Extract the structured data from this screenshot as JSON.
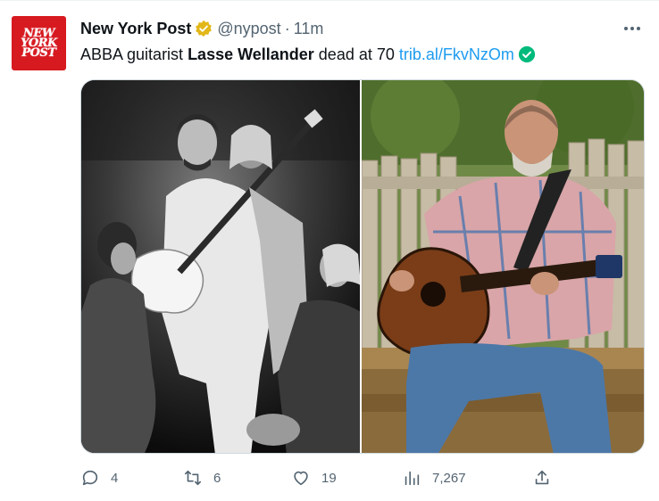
{
  "account": {
    "avatar_text_line1": "NEW",
    "avatar_text_line2": "YORK",
    "avatar_text_line3": "POST",
    "display_name": "New York Post",
    "handle": "@nypost",
    "separator": "·",
    "time": "11m",
    "verified_badge_color": "#e2b719"
  },
  "tweet": {
    "text_part1": "ABBA guitarist ",
    "text_bold": "Lasse Wellander",
    "text_part2": " dead at 70 ",
    "link": "trib.al/FkvNzOm",
    "link_badge_color": "#00ba7c"
  },
  "actions": {
    "replies": "4",
    "retweets": "6",
    "likes": "19",
    "views": "7,267"
  },
  "icons": {
    "more": "more-horizontal-icon",
    "reply": "reply-icon",
    "retweet": "retweet-icon",
    "like": "heart-icon",
    "views": "views-chart-icon",
    "share": "share-icon"
  },
  "colors": {
    "accent": "#1d9bf0",
    "muted": "#536471"
  }
}
